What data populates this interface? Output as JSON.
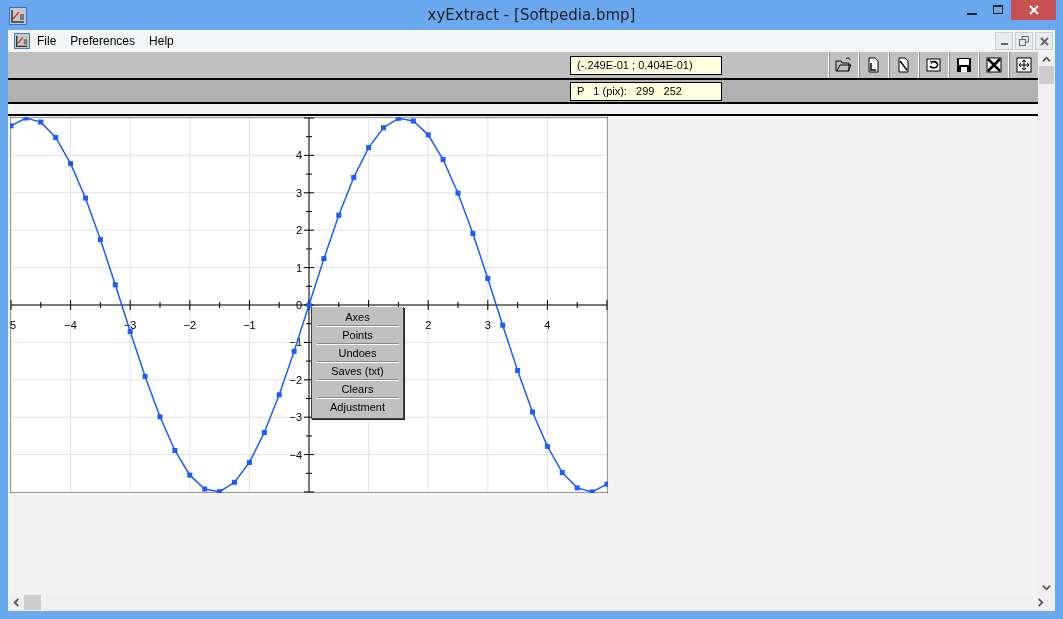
{
  "window": {
    "title": "xyExtract - [Softpedia.bmp]"
  },
  "menu": [
    "File",
    "Preferences",
    "Help"
  ],
  "toolbar": {
    "coordinates": "(-.249E-01 ; 0.404E-01)",
    "point_info": "P   1 (pix):   299   252"
  },
  "plot": {
    "chart_data": {
      "type": "line",
      "xlim": [
        -5,
        5
      ],
      "ylim": [
        -5,
        5
      ],
      "grid": true,
      "xticks": [
        {
          "value": -5,
          "label": "5"
        },
        -4,
        -3,
        -2,
        -1,
        2,
        3,
        4
      ],
      "yticks": [
        -4,
        -3,
        -2,
        -1,
        0,
        1,
        2,
        3,
        4
      ],
      "x": [
        -5,
        -4.75,
        -4.5,
        -4.25,
        -4,
        -3.75,
        -3.5,
        -3.25,
        -3,
        -2.75,
        -2.5,
        -2.25,
        -2,
        -1.75,
        -1.5,
        -1.25,
        -1,
        -0.75,
        -0.5,
        -0.25,
        0,
        0.25,
        0.5,
        0.75,
        1,
        1.25,
        1.5,
        1.75,
        2,
        2.25,
        2.5,
        2.75,
        3,
        3.25,
        3.5,
        3.75,
        4,
        4.25,
        4.5,
        4.75,
        5
      ],
      "series": [
        {
          "color": "#1a5cff",
          "marker": "square",
          "values": [
            4.79,
            5.0,
            4.89,
            4.48,
            3.78,
            2.86,
            1.75,
            0.54,
            -0.71,
            -1.91,
            -2.99,
            -3.89,
            -4.55,
            -4.92,
            -4.99,
            -4.74,
            -4.21,
            -3.41,
            -2.4,
            -1.24,
            0,
            1.24,
            2.4,
            3.41,
            4.21,
            4.74,
            4.99,
            4.92,
            4.55,
            3.89,
            2.99,
            1.91,
            0.71,
            -0.54,
            -1.75,
            -2.86,
            -3.78,
            -4.48,
            -4.89,
            -5.0,
            -4.79
          ]
        }
      ]
    }
  },
  "context_menu": [
    "Axes",
    "Points",
    "Undoes",
    "Saves (txt)",
    "Clears",
    "Adjustment"
  ]
}
